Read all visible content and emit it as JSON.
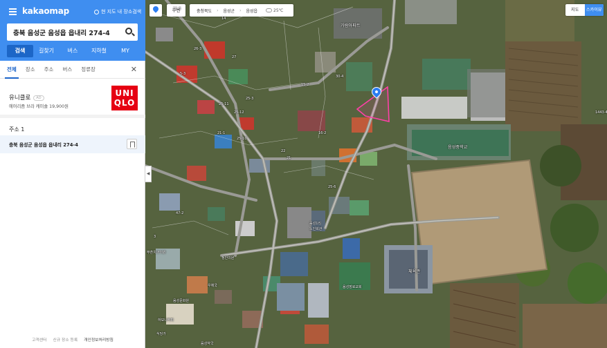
{
  "sidebar": {
    "logo_bold": "kakao",
    "logo_rest": "map",
    "sync_label": "현 지도 내 장소검색",
    "search_value": "충북 음성군 음성읍 읍내리 274-4",
    "tabs": [
      "검색",
      "길찾기",
      "버스",
      "지하철",
      "MY"
    ],
    "sub_tabs": [
      "전체",
      "장소",
      "주소",
      "버스",
      "정류장"
    ],
    "close_symbol": "✕",
    "ad": {
      "title": "유니클로",
      "badge": "AD",
      "desc": "에어리즘 브라 캐미솔 19,900원",
      "logo_top": "UNI",
      "logo_bottom": "QLO"
    },
    "address_header": "주소 1",
    "address_item": "충북 음성군 음성읍 읍내리 274-4",
    "collapse_symbol": "◀",
    "footer": [
      "고객센터",
      "신규 장소 등록",
      "개인정보처리방침"
    ]
  },
  "map": {
    "around_label": "주변",
    "crumbs": [
      "충청북도",
      "음성군",
      "음성읍"
    ],
    "weather": "25℃",
    "map_types": [
      "지도",
      "스카이뷰"
    ],
    "labels": {
      "apt": "가람아파트",
      "school": "음성중학교",
      "gym": "체육관",
      "church": "음성장로교회",
      "hall1": "음성1리",
      "hall2": "노인회관",
      "dental": "부흔치과의원",
      "post": "우체국",
      "market": "하모니커피",
      "pharmacy": "음성약국",
      "restaurant": "식당가",
      "culture": "음성문화원",
      "hospital": "정안의원",
      "n1": "26-3",
      "n2": "25-11",
      "n3": "25-12",
      "n4": "11-6",
      "n5": "30-4",
      "n6": "25-6",
      "n7": "47-2",
      "n8": "21",
      "n9": "22",
      "n10": "14",
      "n11": "27",
      "n12": "15-2",
      "n13": "1443-4",
      "n14": "3",
      "n15": "5-3",
      "n16": "21-1",
      "n17": "25-10",
      "n18": "16-2",
      "n19": "25-3"
    }
  },
  "colors": {
    "kakao_blue": "#3f8ef0",
    "active_tab": "#1c66c7",
    "highlight_polygon": "#ff3fa8",
    "uniqlo_red": "#e60012"
  }
}
